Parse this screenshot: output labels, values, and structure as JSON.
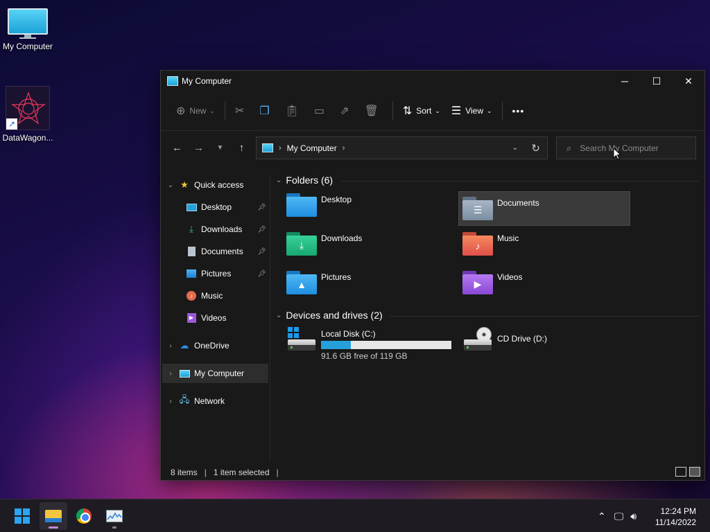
{
  "desktop": {
    "icons": [
      {
        "label": "My Computer",
        "icon": "monitor-icon"
      },
      {
        "label": "DataWagon...",
        "icon": "datawagon-app-icon"
      }
    ]
  },
  "window": {
    "title": "My Computer",
    "toolbar": {
      "new_label": "New",
      "sort_label": "Sort",
      "view_label": "View",
      "more_label": "•••"
    },
    "address": {
      "crumb": "My Computer"
    },
    "search": {
      "placeholder": "Search My Computer"
    },
    "sidebar": {
      "quick_access": "Quick access",
      "items": [
        {
          "label": "Desktop",
          "icon": "desktop-icon"
        },
        {
          "label": "Downloads",
          "icon": "download-icon"
        },
        {
          "label": "Documents",
          "icon": "documents-icon"
        },
        {
          "label": "Pictures",
          "icon": "pictures-icon"
        },
        {
          "label": "Music",
          "icon": "music-icon"
        },
        {
          "label": "Videos",
          "icon": "videos-icon"
        }
      ],
      "onedrive": "OneDrive",
      "my_computer": "My Computer",
      "network": "Network"
    },
    "content": {
      "folders_header": "Folders (6)",
      "folders": [
        {
          "name": "Desktop",
          "color": "#1e9be9"
        },
        {
          "name": "Documents",
          "color": "#8096ad"
        },
        {
          "name": "Downloads",
          "color": "#1fb37a"
        },
        {
          "name": "Music",
          "color": "#e56a4a"
        },
        {
          "name": "Pictures",
          "color": "#1e9be9"
        },
        {
          "name": "Videos",
          "color": "#9b59d9"
        }
      ],
      "drives_header": "Devices and drives (2)",
      "drives": [
        {
          "name": "Local Disk (C:)",
          "free_text": "91.6 GB free of 119 GB",
          "used_fraction": 0.23
        },
        {
          "name": "CD Drive (D:)"
        }
      ]
    },
    "status": {
      "items": "8 items",
      "selected": "1 item selected"
    }
  },
  "taskbar": {
    "time": "12:24 PM",
    "date": "11/14/2022"
  },
  "colors": {
    "accent": "#26a0da",
    "window_bg": "#191919"
  }
}
